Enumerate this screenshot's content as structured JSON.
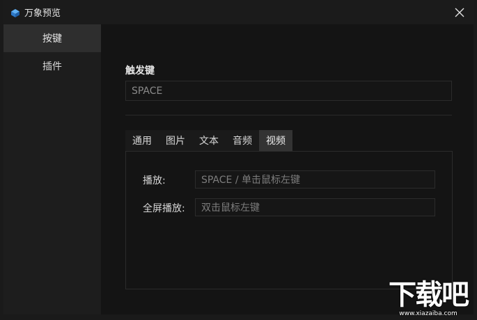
{
  "window": {
    "title": "万象预览",
    "icon": "app-logo-icon",
    "close_icon": "close-icon"
  },
  "sidebar": {
    "items": [
      {
        "label": "按键",
        "active": true
      },
      {
        "label": "插件",
        "active": false
      }
    ]
  },
  "hotkey": {
    "label": "触发键",
    "value": "SPACE"
  },
  "tabs": [
    {
      "label": "通用",
      "active": false
    },
    {
      "label": "图片",
      "active": false
    },
    {
      "label": "文本",
      "active": false
    },
    {
      "label": "音频",
      "active": false
    },
    {
      "label": "视频",
      "active": true
    }
  ],
  "video": {
    "play_label": "播放:",
    "play_value": "SPACE / 单击鼠标左键",
    "fullscreen_label": "全屏播放:",
    "fullscreen_value": "双击鼠标左键"
  },
  "watermark": {
    "main": "下载吧",
    "url": "www.xiazaiba.com"
  },
  "colors": {
    "accent_logo": "#3d8fe0"
  }
}
